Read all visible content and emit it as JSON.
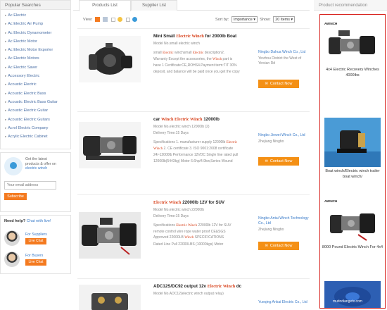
{
  "sidebar": {
    "popular_title": "Popular Searches",
    "categories": [
      "Ac Electric",
      "Ac Electric Air Pump",
      "Ac Electric Dynamometer",
      "Ac Electric Motor",
      "Ac Electric Motor Exporter",
      "Ac Electric Motors",
      "Ac Electric Saver",
      "Accessory Electric",
      "Acoustic Electric",
      "Acoustic Electric Bass",
      "Acoustic Electric Bass Guitar",
      "Acoustic Electric Guitar",
      "Acoustic Electric Guitars",
      "Acrol Electric Company",
      "Acrylic Electric Cabinet"
    ],
    "alert": {
      "line1": "Get the latest",
      "line2": "products & offer on",
      "link": "electric winch",
      "email_placeholder": "Your email address",
      "subscribe_label": "Subscribe"
    },
    "help": {
      "title": "Need help?",
      "chat_link": "Chat with live!",
      "suppliers_label": "For Suppliers",
      "buyers_label": "For Buyers",
      "live_chat_label": "Live Chat"
    }
  },
  "center": {
    "tabs": [
      "Products List",
      "Supplier List"
    ],
    "toolbar": {
      "view_label": "View:",
      "sort_label": "Sort by:",
      "sort_value": "Importance",
      "show_label": "Show:",
      "show_value": "20 Items"
    },
    "contact_label": "Contact Now",
    "products": [
      {
        "title_pre": "Mini Small ",
        "title_kw": "Electric Winch",
        "title_post": " for 2000lb Boat",
        "model": "Model No.small electric winch",
        "desc": [
          [
            "small ",
            "Electric",
            " winchsmall ",
            "Electric",
            " description2."
          ],
          [
            "Warranty Except the accessories, the ",
            "Winch",
            " part is"
          ],
          [
            "have 1 Certificate:CE,ROHS4.Payment term:T/T 30%"
          ],
          [
            "deposit, and balance will be paid once you get the copy"
          ]
        ],
        "company": "Ningbo Dahua Winch Co., Ltd",
        "location": "Yinzhou District the West of Yinxian Rd"
      },
      {
        "title_pre": "car ",
        "title_kw": "Winch Electric Winch",
        "title_post": " 12000lb",
        "model": "Model No.electric winch 12000lb (2)",
        "delivery": "Delivery Time:15 Days",
        "desc": [
          [
            "Specifications 1. manufacturer supply 12000lb ",
            "Electric"
          ],
          [
            "Winch",
            " 2. CE certificate 3. ISO 9001:2008 certificate"
          ],
          [
            "24/-12000lb Performance 12VDC Single line rated pull"
          ],
          [
            "12000lb(5443kg) Motor 6.6hp/4.9kw,Series Wound"
          ]
        ],
        "company": "Ningbo Jinwei Winch Co., Ltd",
        "location": "Zhejiang Ningbo"
      },
      {
        "title_pre": "",
        "title_kw": "Electric Winch",
        "title_post": " 22000lb 12V for SUV",
        "model": "Model No.electric winch 22000lb",
        "delivery": "Delivery Time:15 Days",
        "desc": [
          [
            "Specifications ",
            "Electric Winch",
            " 22000lb 12V for SUV"
          ],
          [
            "remote control wire rope water proof CE&SGS"
          ],
          [
            "Approved 22000LB ",
            "Winch",
            " SPECIFICATIONS"
          ],
          [
            "Rated Line Pull  22000LBS (10000kgs)  Motor"
          ]
        ],
        "company": "Ningbo Antai Winch Technology Co., Ltd",
        "location": "Zhejiang Ningbo"
      },
      {
        "title_pre": "ADC12S/DC92 output 12v ",
        "title_kw": "Electric Winch",
        "title_post": " dc",
        "model": "Model No.ADC12(electric winch output relay)",
        "company": "Yueqing Ankai Electric Co., Ltd"
      }
    ]
  },
  "right": {
    "title": "Product recommendation",
    "items": [
      {
        "brand": "AWINCH",
        "title": "4x4 Electric Recovery Winches 4000lbs"
      },
      {
        "title": "Boat winch/Electric winch trailer boat winch/"
      },
      {
        "brand": "AWINCH",
        "title": "8000 Pound Electric Winch For 4x4"
      },
      {
        "watermark": "mutindiangetx.com"
      }
    ]
  }
}
